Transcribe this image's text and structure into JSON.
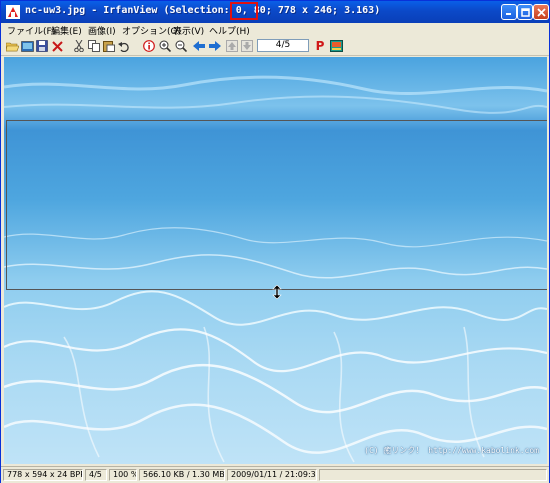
{
  "window": {
    "title": "nc-uw3.jpg - IrfanView (Selection: 0, 80; 778 x 246; 3.163)",
    "selection_highlight": "246",
    "controls": {
      "minimize": "_",
      "maximize": "□",
      "close": "✕"
    }
  },
  "menu": [
    {
      "label": "ファイル(F)"
    },
    {
      "label": "編集(E)"
    },
    {
      "label": "画像(I)"
    },
    {
      "label": "オプション(O)"
    },
    {
      "label": "表示(V)"
    },
    {
      "label": "ヘルプ(H)"
    }
  ],
  "toolbar": {
    "page_value": "4/5",
    "icons": [
      "open-folder-icon",
      "slideshow-icon",
      "save-icon",
      "delete-icon",
      "cut-icon",
      "copy-icon",
      "paste-icon",
      "undo-icon",
      "info-icon",
      "zoom-in-icon",
      "zoom-out-icon",
      "previous-icon",
      "next-icon",
      "first-icon",
      "last-icon",
      "print-icon",
      "paint-icon"
    ],
    "print_glyph": "P"
  },
  "image": {
    "watermark": "(C) 癒リンク！  http://www.kabolink.com"
  },
  "status": {
    "dimensions": "778 x 594 x 24 BPP",
    "page": "4/5",
    "zoom": "100 %",
    "size": "566.10 KB / 1.30 MB",
    "datetime": "2009/01/11 / 21:09:35"
  },
  "colors": {
    "titlebar": "#0b49c8",
    "highlight": "#e01010",
    "water_top": "#4aa3df",
    "water_bottom": "#bfe3f7"
  }
}
